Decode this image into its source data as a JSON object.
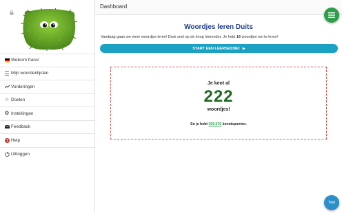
{
  "header": {
    "title": "Dashboard"
  },
  "sidebar": {
    "items": [
      {
        "label": "Welkom frans!",
        "icon": "germany-flag-icon"
      },
      {
        "label": "Mijn woordenlijsten",
        "icon": "list-icon"
      },
      {
        "label": "Vorderingen",
        "icon": "trend-chart-icon"
      },
      {
        "label": "Doelen",
        "icon": "star-icon"
      },
      {
        "label": "Instellingen",
        "icon": "gear-icon"
      },
      {
        "label": "Feedback",
        "icon": "envelope-icon"
      },
      {
        "label": "Help",
        "icon": "help-icon"
      },
      {
        "label": "Uitloggen",
        "icon": "logout-icon"
      }
    ]
  },
  "main": {
    "title": "Woordjes leren Duits",
    "intro_before": "Vandaag gaan we weer woordjes leren! Druk snel op de knop hieronder. Je hebt ",
    "intro_count": "16",
    "intro_after": " woordjes om te leren!",
    "start_button": "START EEN LEERSESSIE!",
    "stats": {
      "known_label": "Je kent al",
      "known_count": "222",
      "known_suffix": "woordjes!",
      "points_before": "En je hebt ",
      "points_value": "309.576",
      "points_after": " kennispunten."
    }
  },
  "fab": {
    "taal_label": "Taal"
  },
  "colors": {
    "accent_blue": "#1aa1c4",
    "title_blue": "#1f3b8c",
    "count_green": "#1c6b1f",
    "fab_green": "#2e9e4a",
    "fab_blue": "#2a8fca",
    "dashed_red": "#d9534f"
  }
}
